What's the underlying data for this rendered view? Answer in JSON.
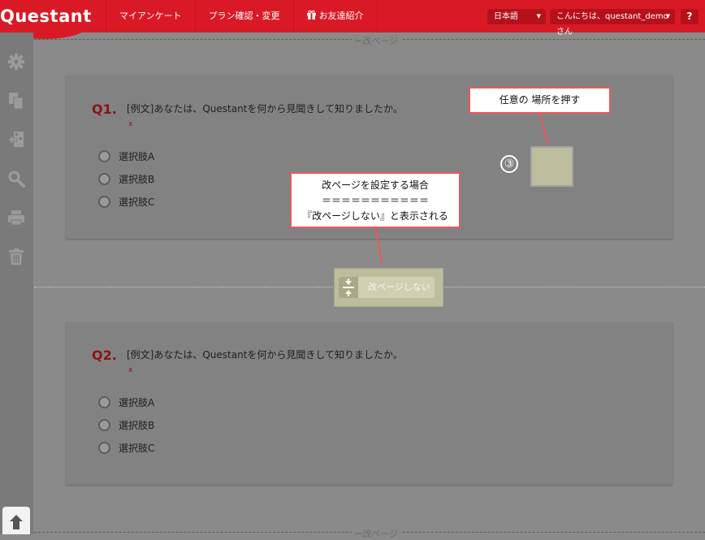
{
  "header": {
    "logo": "Questant",
    "nav": [
      "マイアンケート",
      "プラン確認・変更",
      "お友達紹介"
    ],
    "language": "日本語",
    "user_greeting": "こんにちは、questant_demoさん",
    "help": "?"
  },
  "sidebar": {
    "icons": [
      "gear-icon",
      "copy-icon",
      "import-icon",
      "search-icon",
      "print-icon",
      "trash-icon"
    ],
    "up_icon": "arrow-up-icon"
  },
  "pagebreak": {
    "label": "✂改ページ"
  },
  "questions": [
    {
      "number": "Q1.",
      "text": "[例文]あなたは、Questantを何から見聞きして知りましたか。",
      "required": "x",
      "options": [
        "選択肢A",
        "選択肢B",
        "選択肢C"
      ]
    },
    {
      "number": "Q2.",
      "text": "[例文]あなたは、Questantを何から見聞きして知りましたか。",
      "required": "x",
      "options": [
        "選択肢A",
        "選択肢B",
        "選択肢C"
      ]
    }
  ],
  "toggle": {
    "label": "改ページしない"
  },
  "callouts": {
    "tap_anywhere": "任意の 場所を押す",
    "step": "③",
    "pagebreak_line1": "改ページを設定する場合",
    "pagebreak_line2": "＝＝＝＝＝＝＝＝＝＝＝",
    "pagebreak_line3": "『改ページしない』と表示される"
  },
  "colors": {
    "brand_red": "#d91a26",
    "callout_border": "#e8585e",
    "highlight": "#bdbd9e"
  }
}
